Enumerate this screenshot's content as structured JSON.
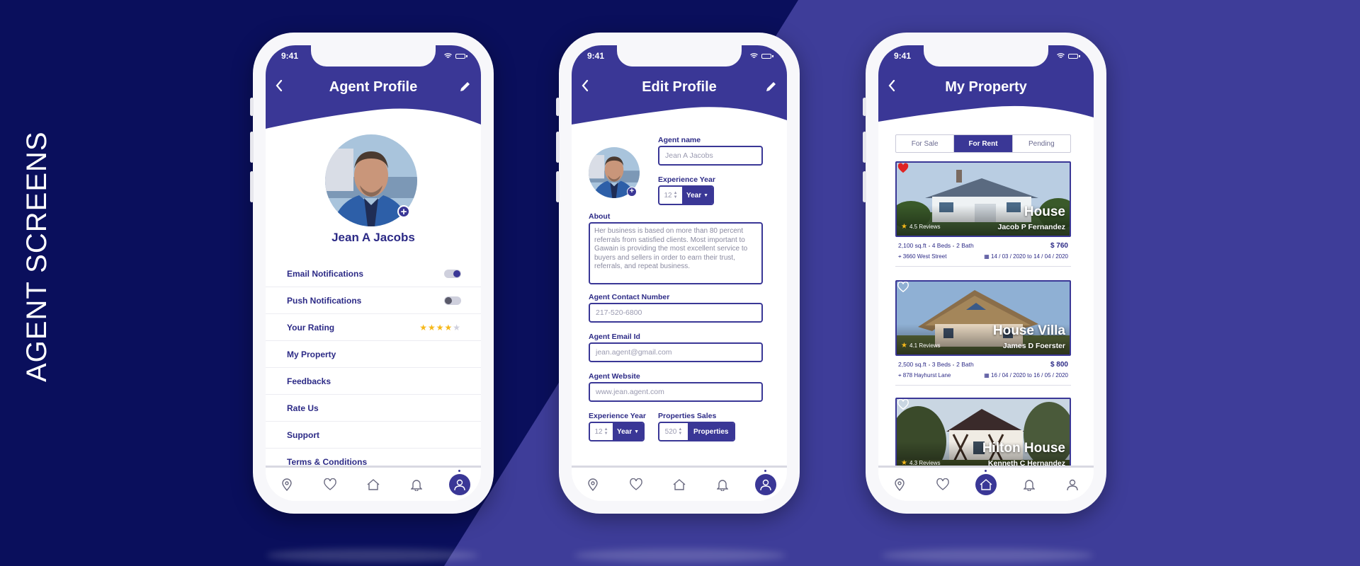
{
  "vertical_title": "AGENT SCREENS",
  "status_time": "9:41",
  "colors": {
    "primary": "#3a3796",
    "dark_bg": "#0a0f5c",
    "light_bg": "#3e3d99",
    "star": "#f6b81a",
    "heart": "#e02424"
  },
  "nav_icons": [
    "location-icon",
    "heart-icon",
    "home-icon",
    "bell-icon",
    "user-icon"
  ],
  "profile": {
    "title": "Agent Profile",
    "name": "Jean A Jacobs",
    "rating": 4,
    "rating_max": 5,
    "menu": {
      "email_notifications": "Email Notifications",
      "email_notifications_on": true,
      "push_notifications": "Push Notifications",
      "push_notifications_on": false,
      "your_rating": "Your Rating",
      "my_property": "My Property",
      "feedbacks": "Feedbacks",
      "rate_us": "Rate Us",
      "support": "Support",
      "terms": "Terms & Conditions"
    }
  },
  "edit": {
    "title": "Edit Profile",
    "agent_name_label": "Agent name",
    "agent_name_value": "Jean A Jacobs",
    "experience_label": "Experience Year",
    "experience_value": "12",
    "experience_unit": "Year",
    "about_label": "About",
    "about_value": "Her business is based on more than 80 percent referrals from satisfied clients. Most important to Gawain is providing the most excellent service to buyers and sellers in order to earn their trust, referrals, and repeat business.",
    "contact_label": "Agent Contact Number",
    "contact_placeholder": "217-520-6800",
    "email_label": "Agent Email Id",
    "email_placeholder": "jean.agent@gmail.com",
    "website_label": "Agent Website",
    "website_placeholder": "www.jean.agent.com",
    "experience2_label": "Experience Year",
    "experience2_value": "12",
    "experience2_unit": "Year",
    "sales_label": "Properties Sales",
    "sales_value": "520",
    "sales_unit": "Properties"
  },
  "property": {
    "title": "My Property",
    "tabs": [
      "For Sale",
      "For Rent",
      "Pending"
    ],
    "active_tab": 1,
    "cards": [
      {
        "name": "House",
        "agent": "Jacob P Fernandez",
        "reviews": "4.5 Reviews",
        "sqft": "2,100 sq.ft",
        "beds": "4 Beds",
        "baths": "2 Bath",
        "price": "$ 760",
        "address": "3660 West Street",
        "dates": "14 / 03 / 2020 to 14 / 04 / 2020",
        "favorite": true
      },
      {
        "name": "House Villa",
        "agent": "James D Foerster",
        "reviews": "4.1 Reviews",
        "sqft": "2,500 sq.ft",
        "beds": "3 Beds",
        "baths": "2 Bath",
        "price": "$ 800",
        "address": "878 Hayhurst Lane",
        "dates": "16 / 04 / 2020 to 16 / 05 / 2020",
        "favorite": false
      },
      {
        "name": "Hilton House",
        "agent": "Kenneth C Hernandez",
        "reviews": "4.3 Reviews",
        "favorite": false
      }
    ]
  }
}
